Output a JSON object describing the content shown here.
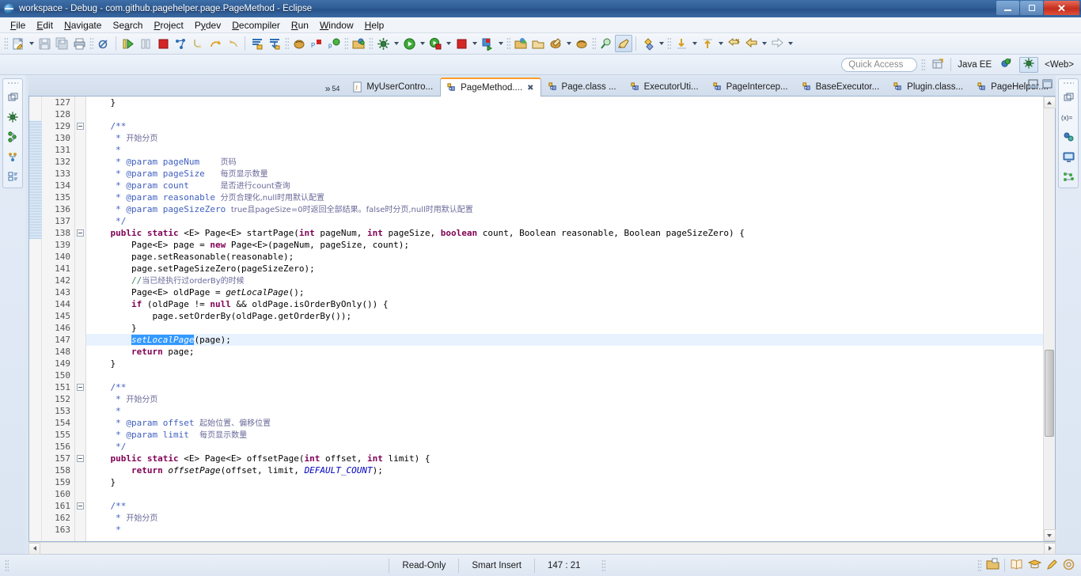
{
  "window": {
    "title": "workspace - Debug - com.github.pagehelper.page.PageMethod - Eclipse",
    "logo_icon": "eclipse-logo-icon",
    "minimize_label": "Minimize",
    "maximize_label": "Maximize",
    "close_label": "Close"
  },
  "menubar": {
    "items": [
      {
        "label": "File",
        "mnemonic": "F"
      },
      {
        "label": "Edit",
        "mnemonic": "E"
      },
      {
        "label": "Navigate",
        "mnemonic": "N"
      },
      {
        "label": "Search",
        "mnemonic": "a"
      },
      {
        "label": "Project",
        "mnemonic": "P"
      },
      {
        "label": "Pydev",
        "mnemonic": "y"
      },
      {
        "label": "Decompiler",
        "mnemonic": "D"
      },
      {
        "label": "Run",
        "mnemonic": "R"
      },
      {
        "label": "Window",
        "mnemonic": "W"
      },
      {
        "label": "Help",
        "mnemonic": "H"
      }
    ]
  },
  "toolbar": {
    "groups": [
      [
        "new-wizard-icon",
        "new-wizard-dropdown",
        "save-icon",
        "save-all-icon",
        "print-icon"
      ],
      [
        "toggle-breakpoint-icon"
      ],
      [
        "resume-icon",
        "suspend-icon",
        "terminate-icon",
        "disconnect-icon",
        "step-into-icon",
        "step-over-icon",
        "step-return-icon"
      ],
      [
        "step-filters-icon",
        "drop-to-frame-icon"
      ],
      [
        "debug-pydev-icon",
        "pydev-package-icon",
        "pydev-plugin-icon"
      ],
      [
        "open-type-icon"
      ],
      [
        "external-tools-icon",
        "external-tools-dropdown",
        "run-icon",
        "run-dropdown",
        "debug-icon",
        "debug-dropdown",
        "stop-icon",
        "stop-dropdown",
        "coverage-icon",
        "coverage-dropdown"
      ],
      [
        "new-java-project-icon",
        "new-package-icon",
        "new-class-icon",
        "new-class-dropdown",
        "new-pydev-icon",
        "new-pydev-dropdown",
        "new-source-folder-icon",
        "new-folder-icon",
        "search-icon",
        "search-dropdown",
        "open-task-icon"
      ],
      [
        "pin-editor-icon"
      ],
      [
        "annotation-icon",
        "annotation-dropdown"
      ],
      [
        "next-annotation-icon",
        "next-annotation-dropdown",
        "previous-annotation-icon",
        "previous-annotation-dropdown",
        "last-edit-icon",
        "back-icon",
        "back-dropdown",
        "forward-icon",
        "forward-dropdown"
      ]
    ]
  },
  "quick_access": {
    "placeholder": "Quick Access",
    "restore_perspective_icon": "open-perspective-icon",
    "perspectives": [
      {
        "label": "Java EE",
        "icon": "java-ee-perspective-icon",
        "active": false
      },
      {
        "label": "",
        "icon": "pydev-perspective-icon",
        "active": false
      },
      {
        "label": "",
        "icon": "debug-perspective-icon",
        "active": true
      },
      {
        "label": "<Web>",
        "icon": "web-perspective-icon",
        "active": false
      }
    ]
  },
  "left_rail": {
    "dots_icon": "grip-dots-icon",
    "items": [
      {
        "icon": "restore-view-icon",
        "name": "restore-minimized-views"
      },
      {
        "icon": "debug-view-icon",
        "name": "debug-view"
      },
      {
        "icon": "breakpoints-view-icon",
        "name": "breakpoints-view"
      },
      {
        "icon": "servers-view-icon",
        "name": "servers-view"
      },
      {
        "icon": "outline-view-icon",
        "name": "outline-view"
      }
    ]
  },
  "right_rail": {
    "dots_icon": "grip-dots-icon",
    "items": [
      {
        "icon": "restore-view-icon",
        "name": "restore-minimized-views"
      },
      {
        "icon": "variables-view-icon",
        "name": "variables-view"
      },
      {
        "icon": "expressions-view-icon",
        "name": "expressions-view"
      },
      {
        "icon": "display-view-icon",
        "name": "display-view"
      },
      {
        "icon": "hierarchy-view-icon",
        "name": "hierarchy-view"
      }
    ]
  },
  "editor": {
    "tabs": [
      {
        "label": "MyUserContro...",
        "icon": "java-file-icon",
        "active": false,
        "closeable": false
      },
      {
        "label": "PageMethod....",
        "icon": "class-file-icon",
        "active": true,
        "closeable": true
      },
      {
        "label": "Page.class ...",
        "icon": "class-file-icon",
        "active": false,
        "closeable": false
      },
      {
        "label": "ExecutorUti...",
        "icon": "class-file-icon",
        "active": false,
        "closeable": false
      },
      {
        "label": "PageIntercep...",
        "icon": "class-file-icon",
        "active": false,
        "closeable": false
      },
      {
        "label": "BaseExecutor...",
        "icon": "class-file-icon",
        "active": false,
        "closeable": false
      },
      {
        "label": "Plugin.class...",
        "icon": "class-file-icon",
        "active": false,
        "closeable": false
      },
      {
        "label": "PageHelper....",
        "icon": "class-file-icon",
        "active": false,
        "closeable": false
      }
    ],
    "overflow": {
      "chevrons": "»",
      "count": "54"
    },
    "minimize_icon": "minimize-editor-icon",
    "maximize_icon": "maximize-editor-icon",
    "highlight_line": 147,
    "first_line": 127,
    "lines": [
      {
        "n": 127,
        "fold": false,
        "marked": false,
        "tokens": [
          {
            "t": "    }",
            "c": "typ"
          }
        ]
      },
      {
        "n": 128,
        "fold": false,
        "marked": false,
        "tokens": [
          {
            "t": "",
            "c": "typ"
          }
        ]
      },
      {
        "n": 129,
        "fold": true,
        "marked": true,
        "tokens": [
          {
            "t": "    /**",
            "c": "cmt"
          }
        ]
      },
      {
        "n": 130,
        "fold": false,
        "marked": true,
        "tokens": [
          {
            "t": "     * ",
            "c": "cmt"
          },
          {
            "t": "开始分页",
            "c": "cn"
          }
        ]
      },
      {
        "n": 131,
        "fold": false,
        "marked": true,
        "tokens": [
          {
            "t": "     *",
            "c": "cmt"
          }
        ]
      },
      {
        "n": 132,
        "fold": false,
        "marked": true,
        "tokens": [
          {
            "t": "     * @param pageNum    ",
            "c": "cmt"
          },
          {
            "t": "页码",
            "c": "cn"
          }
        ]
      },
      {
        "n": 133,
        "fold": false,
        "marked": true,
        "tokens": [
          {
            "t": "     * @param pageSize   ",
            "c": "cmt"
          },
          {
            "t": "每页显示数量",
            "c": "cn"
          }
        ]
      },
      {
        "n": 134,
        "fold": false,
        "marked": true,
        "tokens": [
          {
            "t": "     * @param count      ",
            "c": "cmt"
          },
          {
            "t": "是否进行count查询",
            "c": "cn"
          }
        ]
      },
      {
        "n": 135,
        "fold": false,
        "marked": true,
        "tokens": [
          {
            "t": "     * @param reasonable ",
            "c": "cmt"
          },
          {
            "t": "分页合理化,null时用默认配置",
            "c": "cn"
          }
        ]
      },
      {
        "n": 136,
        "fold": false,
        "marked": true,
        "tokens": [
          {
            "t": "     * @param pageSizeZero ",
            "c": "cmt"
          },
          {
            "t": "true且pageSize=0时返回全部结果。false时分页,null时用默认配置",
            "c": "cn"
          }
        ]
      },
      {
        "n": 137,
        "fold": false,
        "marked": true,
        "tokens": [
          {
            "t": "     */",
            "c": "cmt"
          }
        ]
      },
      {
        "n": 138,
        "fold": true,
        "marked": true,
        "tokens": [
          {
            "t": "    ",
            "c": "typ"
          },
          {
            "t": "public static",
            "c": "kw"
          },
          {
            "t": " <E> Page<E> startPage(",
            "c": "typ"
          },
          {
            "t": "int",
            "c": "kw"
          },
          {
            "t": " pageNum, ",
            "c": "typ"
          },
          {
            "t": "int",
            "c": "kw"
          },
          {
            "t": " pageSize, ",
            "c": "typ"
          },
          {
            "t": "boolean",
            "c": "kw"
          },
          {
            "t": " count, Boolean reasonable, Boolean pageSizeZero) {",
            "c": "typ"
          }
        ]
      },
      {
        "n": 139,
        "fold": false,
        "marked": false,
        "tokens": [
          {
            "t": "        Page<E> page = ",
            "c": "typ"
          },
          {
            "t": "new",
            "c": "kw"
          },
          {
            "t": " Page<E>(pageNum, pageSize, count);",
            "c": "typ"
          }
        ]
      },
      {
        "n": 140,
        "fold": false,
        "marked": false,
        "tokens": [
          {
            "t": "        page.setReasonable(reasonable);",
            "c": "typ"
          }
        ]
      },
      {
        "n": 141,
        "fold": false,
        "marked": false,
        "tokens": [
          {
            "t": "        page.setPageSizeZero(pageSizeZero);",
            "c": "typ"
          }
        ]
      },
      {
        "n": 142,
        "fold": false,
        "marked": false,
        "tokens": [
          {
            "t": "        //",
            "c": "cmtl"
          },
          {
            "t": "当已经执行过orderBy的时候",
            "c": "cn"
          }
        ]
      },
      {
        "n": 143,
        "fold": false,
        "marked": false,
        "tokens": [
          {
            "t": "        Page<E> oldPage = ",
            "c": "typ"
          },
          {
            "t": "getLocalPage",
            "c": "stat"
          },
          {
            "t": "();",
            "c": "typ"
          }
        ]
      },
      {
        "n": 144,
        "fold": false,
        "marked": false,
        "tokens": [
          {
            "t": "        ",
            "c": "typ"
          },
          {
            "t": "if",
            "c": "kw"
          },
          {
            "t": " (oldPage != ",
            "c": "typ"
          },
          {
            "t": "null",
            "c": "kw"
          },
          {
            "t": " && oldPage.isOrderByOnly()) {",
            "c": "typ"
          }
        ]
      },
      {
        "n": 145,
        "fold": false,
        "marked": false,
        "tokens": [
          {
            "t": "            page.setOrderBy(oldPage.getOrderBy());",
            "c": "typ"
          }
        ]
      },
      {
        "n": 146,
        "fold": false,
        "marked": false,
        "tokens": [
          {
            "t": "        }",
            "c": "typ"
          }
        ]
      },
      {
        "n": 147,
        "fold": false,
        "marked": false,
        "tokens": [
          {
            "t": "        ",
            "c": "typ"
          },
          {
            "t": "setLocalPage",
            "c": "sel"
          },
          {
            "t": "(page);",
            "c": "typ"
          }
        ]
      },
      {
        "n": 148,
        "fold": false,
        "marked": false,
        "tokens": [
          {
            "t": "        ",
            "c": "typ"
          },
          {
            "t": "return",
            "c": "kw"
          },
          {
            "t": " page;",
            "c": "typ"
          }
        ]
      },
      {
        "n": 149,
        "fold": false,
        "marked": false,
        "tokens": [
          {
            "t": "    }",
            "c": "typ"
          }
        ]
      },
      {
        "n": 150,
        "fold": false,
        "marked": false,
        "tokens": [
          {
            "t": "",
            "c": "typ"
          }
        ]
      },
      {
        "n": 151,
        "fold": true,
        "marked": false,
        "tokens": [
          {
            "t": "    /**",
            "c": "cmt"
          }
        ]
      },
      {
        "n": 152,
        "fold": false,
        "marked": false,
        "tokens": [
          {
            "t": "     * ",
            "c": "cmt"
          },
          {
            "t": "开始分页",
            "c": "cn"
          }
        ]
      },
      {
        "n": 153,
        "fold": false,
        "marked": false,
        "tokens": [
          {
            "t": "     *",
            "c": "cmt"
          }
        ]
      },
      {
        "n": 154,
        "fold": false,
        "marked": false,
        "tokens": [
          {
            "t": "     * @param offset ",
            "c": "cmt"
          },
          {
            "t": "起始位置、偏移位置",
            "c": "cn"
          }
        ]
      },
      {
        "n": 155,
        "fold": false,
        "marked": false,
        "tokens": [
          {
            "t": "     * @param limit  ",
            "c": "cmt"
          },
          {
            "t": "每页显示数量",
            "c": "cn"
          }
        ]
      },
      {
        "n": 156,
        "fold": false,
        "marked": false,
        "tokens": [
          {
            "t": "     */",
            "c": "cmt"
          }
        ]
      },
      {
        "n": 157,
        "fold": true,
        "marked": false,
        "tokens": [
          {
            "t": "    ",
            "c": "typ"
          },
          {
            "t": "public static",
            "c": "kw"
          },
          {
            "t": " <E> Page<E> offsetPage(",
            "c": "typ"
          },
          {
            "t": "int",
            "c": "kw"
          },
          {
            "t": " offset, ",
            "c": "typ"
          },
          {
            "t": "int",
            "c": "kw"
          },
          {
            "t": " limit) {",
            "c": "typ"
          }
        ]
      },
      {
        "n": 158,
        "fold": false,
        "marked": false,
        "tokens": [
          {
            "t": "        ",
            "c": "typ"
          },
          {
            "t": "return",
            "c": "kw"
          },
          {
            "t": " ",
            "c": "typ"
          },
          {
            "t": "offsetPage",
            "c": "stat"
          },
          {
            "t": "(offset, limit, ",
            "c": "typ"
          },
          {
            "t": "DEFAULT_COUNT",
            "c": "fld"
          },
          {
            "t": ");",
            "c": "typ"
          }
        ]
      },
      {
        "n": 159,
        "fold": false,
        "marked": false,
        "tokens": [
          {
            "t": "    }",
            "c": "typ"
          }
        ]
      },
      {
        "n": 160,
        "fold": false,
        "marked": false,
        "tokens": [
          {
            "t": "",
            "c": "typ"
          }
        ]
      },
      {
        "n": 161,
        "fold": true,
        "marked": false,
        "tokens": [
          {
            "t": "    /**",
            "c": "cmt"
          }
        ]
      },
      {
        "n": 162,
        "fold": false,
        "marked": false,
        "tokens": [
          {
            "t": "     * ",
            "c": "cmt"
          },
          {
            "t": "开始分页",
            "c": "cn"
          }
        ]
      },
      {
        "n": 163,
        "fold": false,
        "marked": false,
        "tokens": [
          {
            "t": "     *",
            "c": "cmt"
          }
        ]
      }
    ]
  },
  "statusbar": {
    "read_only": "Read-Only",
    "insert_mode": "Smart Insert",
    "position": "147 : 21",
    "grip_icon": "grip-dots-icon",
    "right_icons": [
      {
        "icon": "build-icon",
        "name": "build-status-icon"
      },
      {
        "icon": "book-icon",
        "name": "tip-of-day-icon"
      },
      {
        "icon": "graduation-icon",
        "name": "learn-icon"
      },
      {
        "icon": "pencil-icon",
        "name": "edit-icon"
      },
      {
        "icon": "circle-icon",
        "name": "progress-icon"
      }
    ]
  }
}
